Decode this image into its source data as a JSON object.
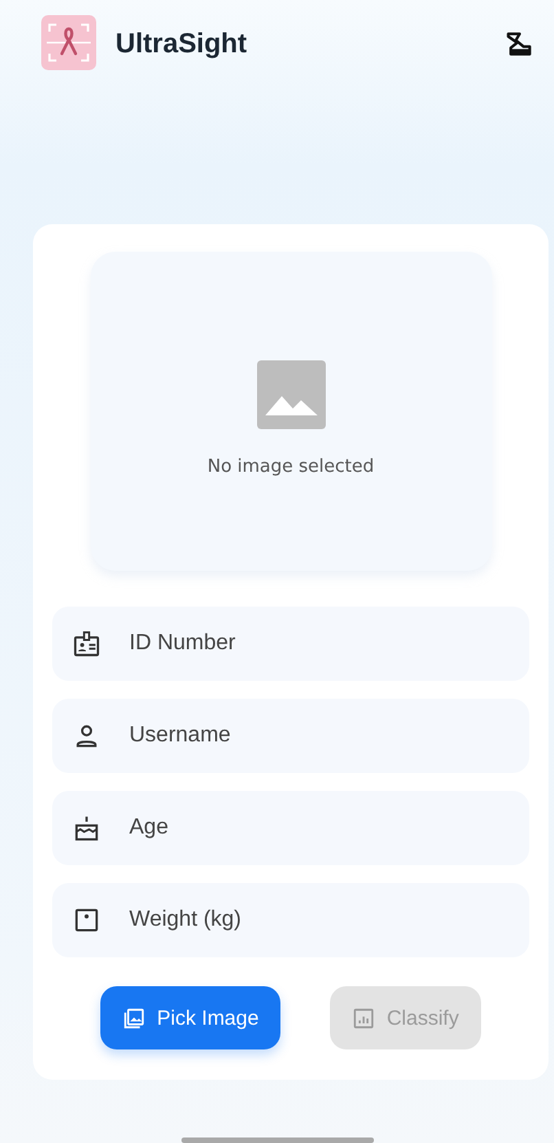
{
  "app_bar": {
    "title": "UltraSight"
  },
  "image_preview": {
    "empty_text": "No image selected"
  },
  "fields": [
    {
      "placeholder": "ID Number"
    },
    {
      "placeholder": "Username"
    },
    {
      "placeholder": "Age"
    },
    {
      "placeholder": "Weight (kg)"
    }
  ],
  "buttons": [
    {
      "label": "Pick Image",
      "disabled": false
    },
    {
      "label": "Classify",
      "disabled": true
    }
  ]
}
